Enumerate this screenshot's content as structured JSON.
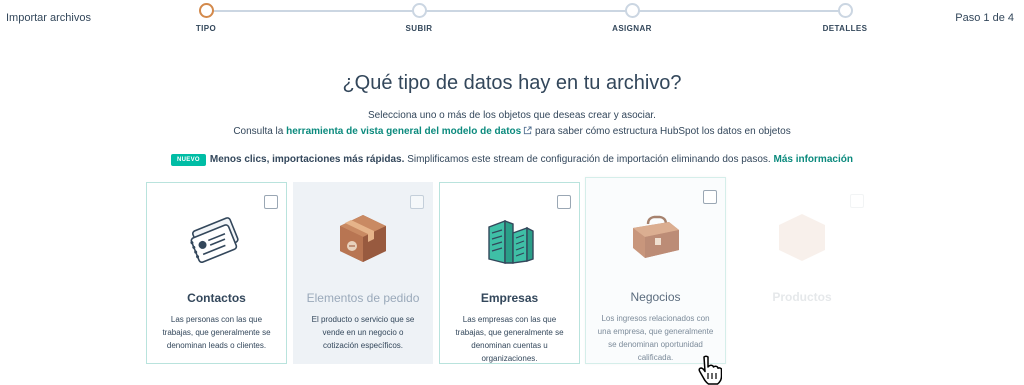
{
  "header": {
    "app_title": "Importar archivos",
    "step_count": "Paso 1 de 4"
  },
  "stepper": {
    "steps": [
      {
        "label": "TIPO",
        "active": true
      },
      {
        "label": "SUBIR",
        "active": false
      },
      {
        "label": "ASIGNAR",
        "active": false
      },
      {
        "label": "DETALLES",
        "active": false
      }
    ],
    "accent_color": "#d3894b",
    "inactive_color": "#cbd6e2"
  },
  "main": {
    "heading": "¿Qué tipo de datos hay en tu archivo?",
    "subtitle": "Selecciona uno o más de los objetos que deseas crear y asociar.",
    "consult_prefix": "Consulta la",
    "consult_link": "herramienta de vista general del modelo de datos",
    "consult_suffix": "para saber cómo estructura HubSpot los datos en objetos"
  },
  "notice": {
    "badge": "NUEVO",
    "bold_text": "Menos clics, importaciones más rápidas.",
    "text": "Simplificamos este stream de configuración de importación eliminando dos pasos.",
    "link": "Más información"
  },
  "cards": [
    {
      "title": "Contactos",
      "description": "Las personas con las que trabajas, que generalmente se denominan leads o clientes.",
      "icon": "contacts-cards-icon",
      "state": "normal"
    },
    {
      "title": "Elementos de pedido",
      "description": "El producto o servicio que se vende en un negocio o cotización específicos.",
      "icon": "package-box-icon",
      "state": "disabled"
    },
    {
      "title": "Empresas",
      "description": "Las empresas con las que trabajas, que generalmente se denominan cuentas u organizaciones.",
      "icon": "buildings-icon",
      "state": "normal"
    },
    {
      "title": "Negocios",
      "description": "Los ingresos relacionados con una empresa, que generalmente se denominan oportunidad calificada.",
      "icon": "briefcase-icon",
      "state": "hover"
    },
    {
      "title": "Productos",
      "description": "",
      "icon": "product-box-icon",
      "state": "faded"
    }
  ],
  "colors": {
    "link": "#0b8a7d",
    "badge": "#00bda5",
    "text": "#33475b",
    "card_border": "#b9e3dd"
  }
}
